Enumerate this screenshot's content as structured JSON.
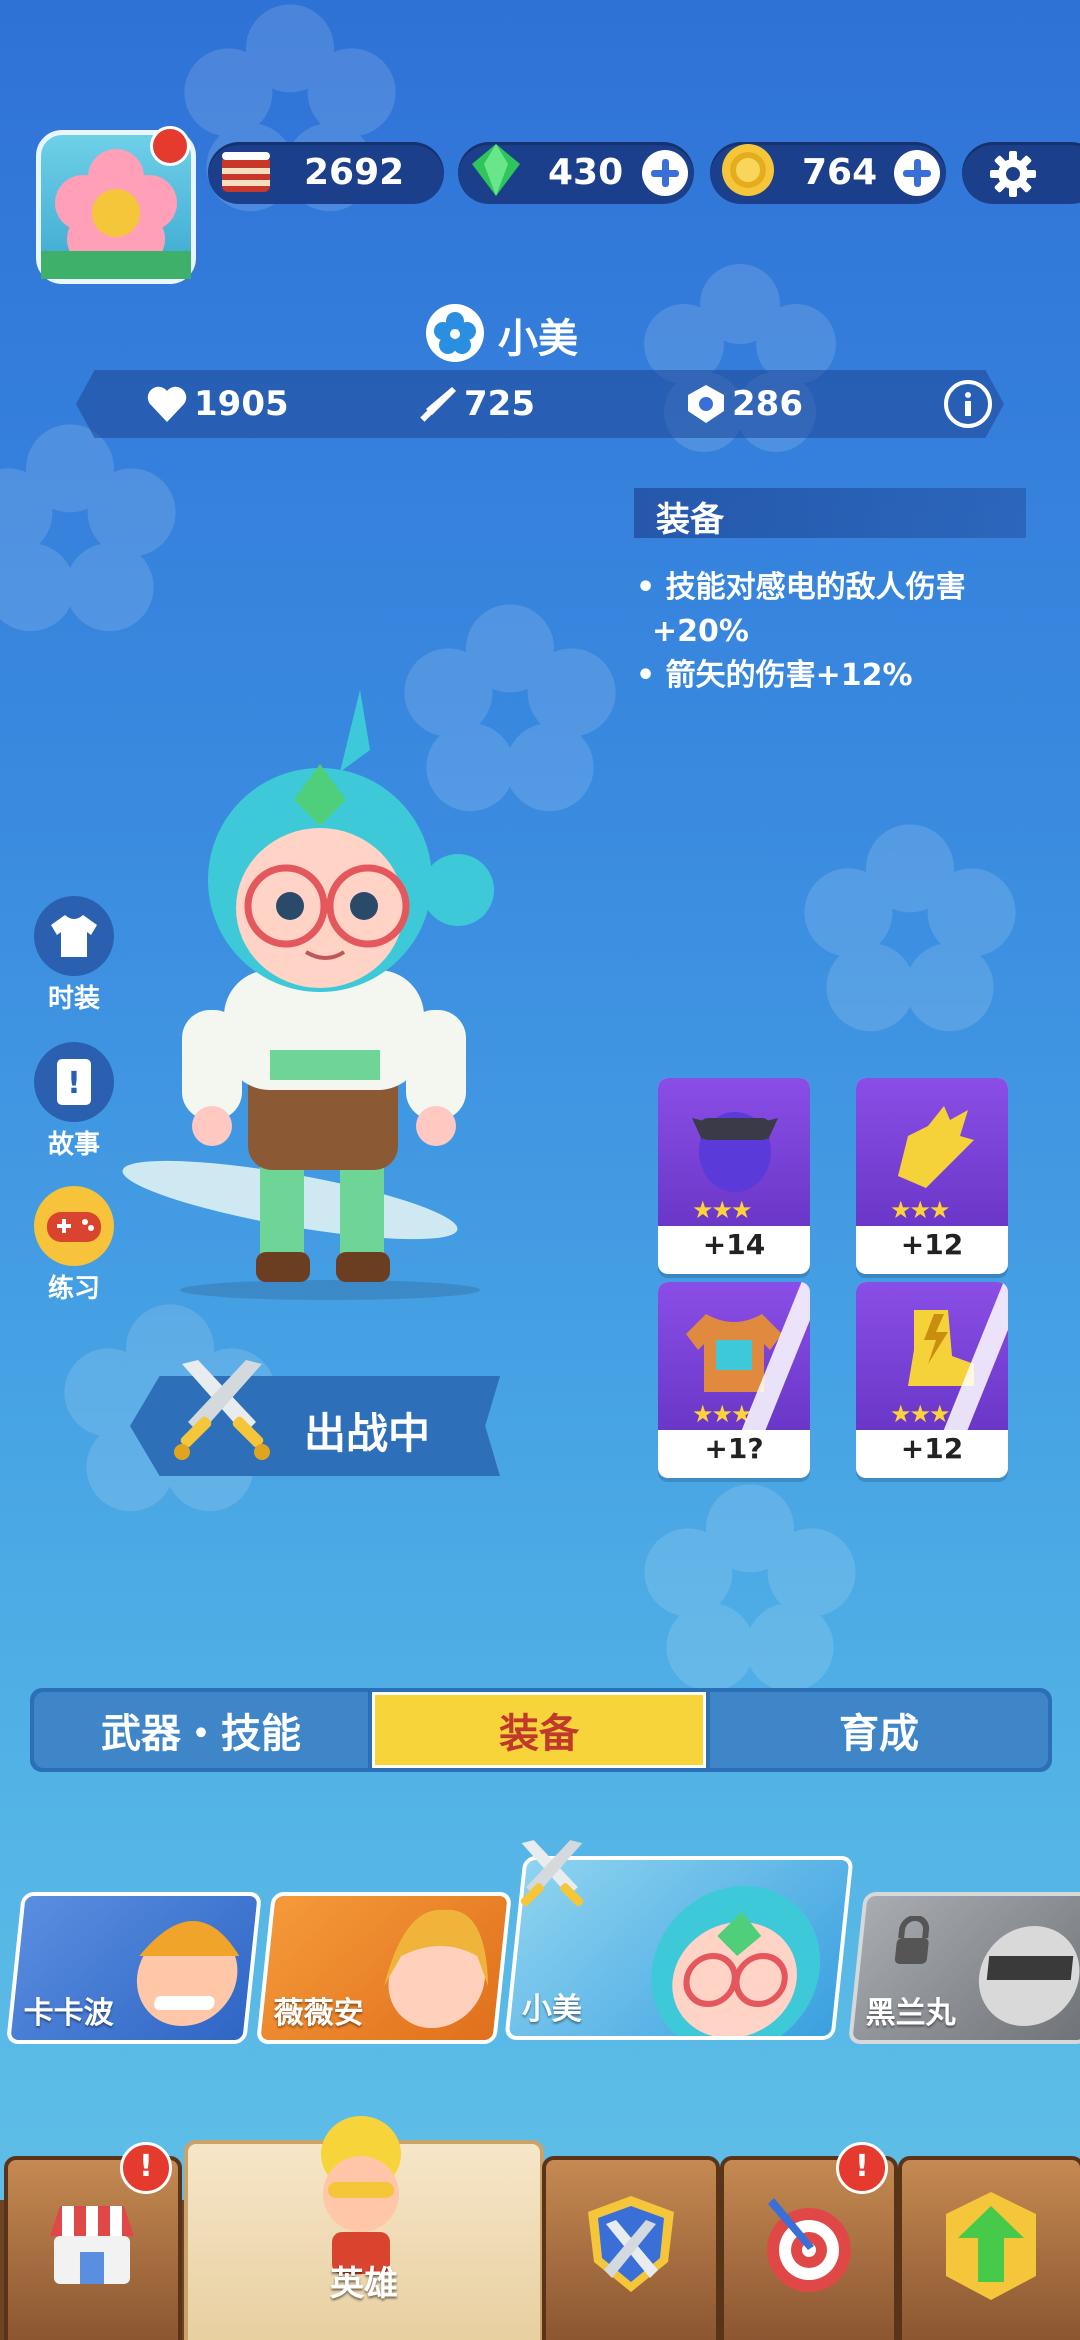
{
  "resources": {
    "cake": "2692",
    "gem": "430",
    "coin": "764"
  },
  "hero": {
    "name": "小美",
    "stats": {
      "hp": "1905",
      "attack": "725",
      "defense": "286"
    }
  },
  "equipment_panel": {
    "title": "装备",
    "bonus_lines": [
      "技能对感电的敌人伤害",
      "+20%",
      "箭矢的伤害+12%"
    ]
  },
  "side_menu": [
    {
      "label": "时装",
      "icon": "tshirt-icon"
    },
    {
      "label": "故事",
      "icon": "story-scroll-icon"
    },
    {
      "label": "练习",
      "icon": "gamepad-icon"
    }
  ],
  "status_banner": "出战中",
  "equip_slots": [
    {
      "level": "+14",
      "icon": "helmet-icon",
      "stars": 3
    },
    {
      "level": "+12",
      "icon": "gloves-icon",
      "stars": 3
    },
    {
      "level": "+1?",
      "icon": "armor-icon",
      "stars": 3
    },
    {
      "level": "+12",
      "icon": "boots-icon",
      "stars": 3
    }
  ],
  "tabs": [
    {
      "label": "武器・技能"
    },
    {
      "label": "装备",
      "active": true
    },
    {
      "label": "育成"
    }
  ],
  "hero_list": [
    {
      "name": "卡卡波",
      "locked": false
    },
    {
      "name": "薇薇安",
      "locked": false
    },
    {
      "name": "小美",
      "selected": true
    },
    {
      "name": "黑兰丸",
      "locked": true
    }
  ],
  "bottom_nav": [
    {
      "label": "",
      "icon": "shop-icon",
      "alert": "!"
    },
    {
      "label": "英雄",
      "icon": "hero-icon",
      "active": true
    },
    {
      "label": "",
      "icon": "battle-shield-icon"
    },
    {
      "label": "",
      "icon": "target-icon",
      "alert": "!"
    },
    {
      "label": "",
      "icon": "upgrade-arrow-icon"
    }
  ],
  "colors": {
    "accent_yellow": "#f7d43a",
    "tab_blue": "#3f86c9",
    "panel_navy": "#1b3f8a"
  }
}
